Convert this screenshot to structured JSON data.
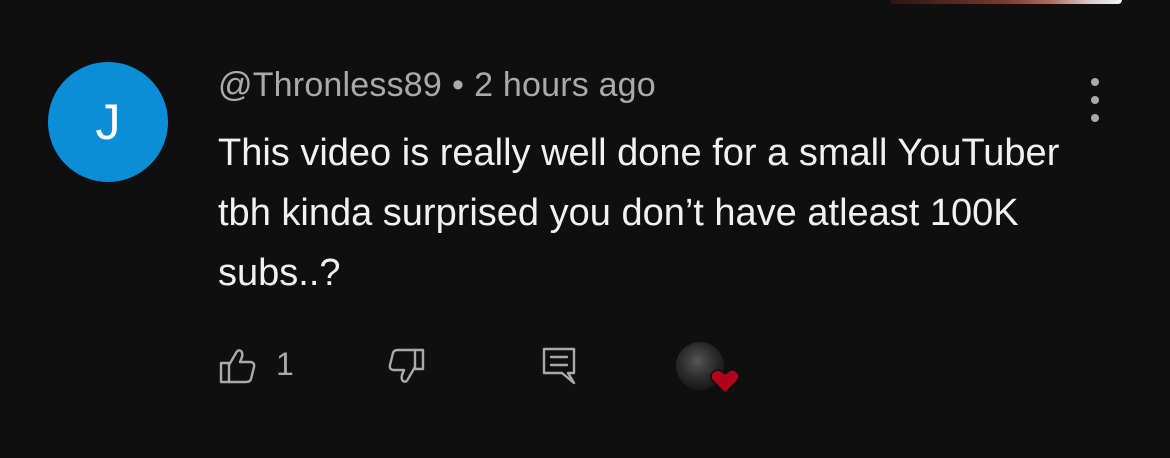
{
  "comment": {
    "avatar_letter": "J",
    "avatar_color": "#0b8ed8",
    "author": "@Thronless89",
    "separator": "•",
    "timestamp": "2 hours ago",
    "text": "This video is really well done for a small YouTuber tbh kinda surprised you don’t have atleast 100K subs..?"
  },
  "actions": {
    "like_icon": "thumbs-up-icon",
    "like_count": "1",
    "dislike_icon": "thumbs-down-icon",
    "reply_icon": "reply-icon",
    "creator_heart_icon": "heart-icon",
    "heart_color": "#b3001b"
  },
  "menu": {
    "icon": "more-vert-icon"
  }
}
